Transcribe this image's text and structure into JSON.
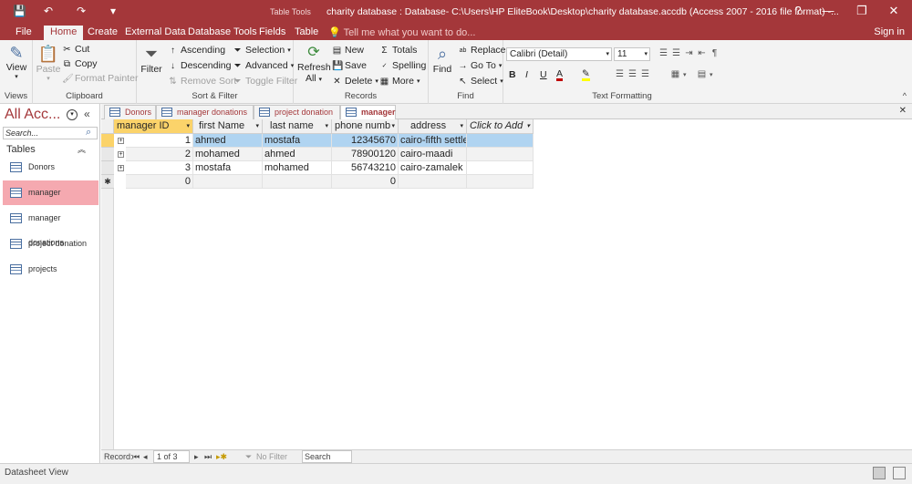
{
  "titlebar": {
    "context_tab": "Table Tools",
    "title": "charity database : Database- C:\\Users\\HP EliteBook\\Desktop\\charity database.accdb (Access 2007 - 2016 file format) -...",
    "help": "?",
    "minimize": "—",
    "restore": "❐",
    "close": "✕",
    "save_icon": "💾",
    "undo_icon": "↶",
    "redo_icon": "↷",
    "customize_icon": "▾"
  },
  "tabs": [
    "File",
    "Home",
    "Create",
    "External Data",
    "Database Tools",
    "Fields",
    "Table"
  ],
  "tell_me": "Tell me what you want to do...",
  "sign_in": "Sign in",
  "ribbon": {
    "views": {
      "view": "View",
      "label": "Views"
    },
    "clipboard": {
      "paste": "Paste",
      "cut": "Cut",
      "copy": "Copy",
      "format_painter": "Format Painter",
      "label": "Clipboard"
    },
    "sort_filter": {
      "filter": "Filter",
      "ascending": "Ascending",
      "descending": "Descending",
      "remove_sort": "Remove Sort",
      "selection": "Selection",
      "advanced": "Advanced",
      "toggle_filter": "Toggle Filter",
      "label": "Sort & Filter"
    },
    "records": {
      "refresh": "Refresh",
      "refresh_all": "All",
      "new": "New",
      "save": "Save",
      "delete": "Delete",
      "totals": "Totals",
      "spelling": "Spelling",
      "more": "More",
      "label": "Records"
    },
    "find": {
      "find": "Find",
      "replace": "Replace",
      "goto": "Go To",
      "select": "Select",
      "label": "Find"
    },
    "text_formatting": {
      "font": "Calibri (Detail)",
      "size": "11",
      "bold": "B",
      "italic": "I",
      "underline": "U",
      "font_color": "A",
      "label": "Text Formatting"
    }
  },
  "nav": {
    "title": "All Acc...",
    "search_placeholder": "Search...",
    "section": "Tables",
    "items": [
      "Donors",
      "manager",
      "manager donations",
      "project donation",
      "projects"
    ],
    "selected": "manager"
  },
  "doc_tabs": [
    "Donors",
    "manager donations",
    "project donation",
    "manager"
  ],
  "active_doc_tab": "manager",
  "columns": [
    "manager ID",
    "first Name",
    "last name",
    "phone numb",
    "address",
    "Click to Add"
  ],
  "rows": [
    {
      "id": "1",
      "first": "ahmed",
      "last": "mostafa",
      "phone": "12345670",
      "address": "cairo-fifth settle"
    },
    {
      "id": "2",
      "first": "mohamed",
      "last": "ahmed",
      "phone": "78900120",
      "address": "cairo-maadi"
    },
    {
      "id": "3",
      "first": "mostafa",
      "last": "mohamed",
      "phone": "56743210",
      "address": "cairo-zamalek"
    }
  ],
  "new_row": {
    "id": "0",
    "phone": "0",
    "marker": "✱"
  },
  "record_nav": {
    "label": "Record:",
    "position": "1 of 3",
    "no_filter": "No Filter",
    "search": "Search"
  },
  "status": {
    "view": "Datasheet View"
  }
}
